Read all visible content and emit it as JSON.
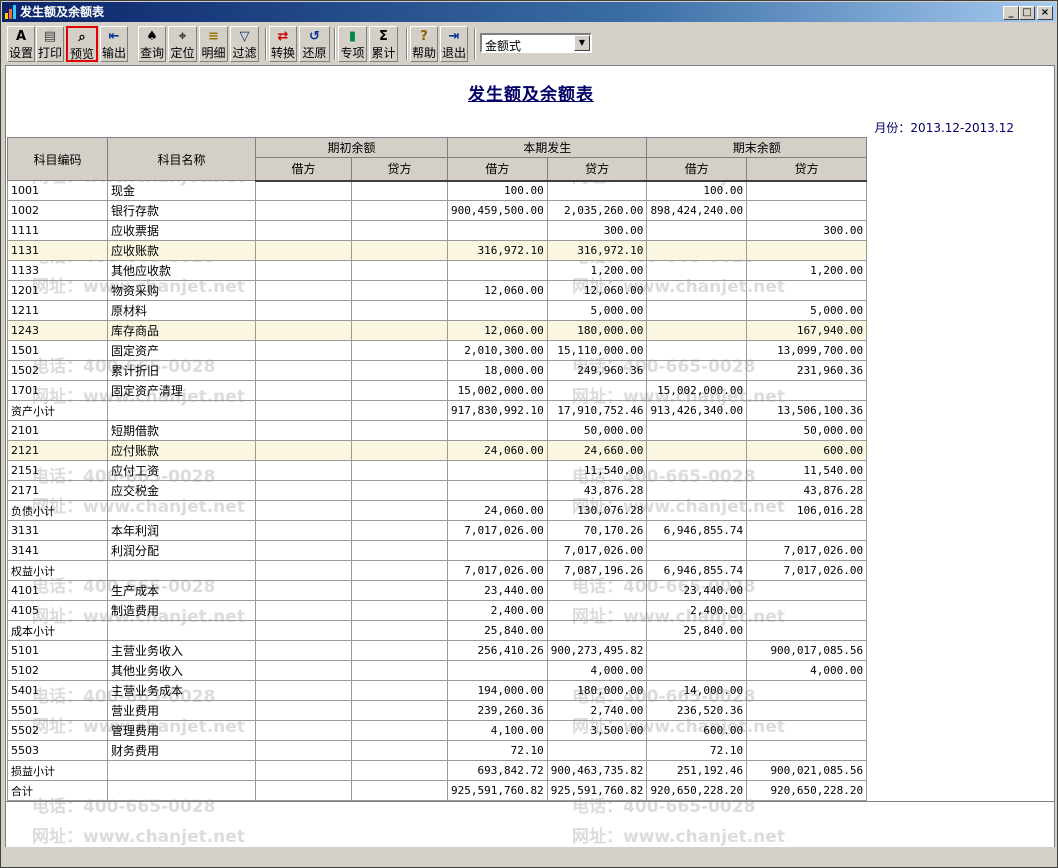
{
  "window": {
    "title": "发生额及余额表",
    "min": "_",
    "max": "□",
    "close": "×"
  },
  "toolbar": [
    {
      "id": "settings",
      "label": "设置"
    },
    {
      "id": "print",
      "label": "打印"
    },
    {
      "id": "preview",
      "label": "预览"
    },
    {
      "id": "export",
      "label": "输出"
    },
    {
      "id": "query",
      "label": "查询"
    },
    {
      "id": "locate",
      "label": "定位"
    },
    {
      "id": "detail",
      "label": "明细"
    },
    {
      "id": "filter",
      "label": "过滤"
    },
    {
      "id": "convert",
      "label": "转换"
    },
    {
      "id": "restore",
      "label": "还原"
    },
    {
      "id": "special",
      "label": "专项"
    },
    {
      "id": "cumulative",
      "label": "累计"
    },
    {
      "id": "help",
      "label": "帮助"
    },
    {
      "id": "exit",
      "label": "退出"
    }
  ],
  "format_select": {
    "value": "金额式"
  },
  "report": {
    "title": "发生额及余额表",
    "period": "月份：2013.12-2013.12"
  },
  "watermark": {
    "phone": "电话：400-665-0028",
    "site": "网址：www.chanjet.net"
  },
  "columns": {
    "code": "科目编码",
    "name": "科目名称",
    "opening": "期初余额",
    "current": "本期发生",
    "closing": "期末余额",
    "debit": "借方",
    "credit": "贷方"
  },
  "rows": [
    [
      "1001",
      "现金",
      "",
      "",
      "100.00",
      "",
      "100.00",
      ""
    ],
    [
      "1002",
      "银行存款",
      "",
      "",
      "900,459,500.00",
      "2,035,260.00",
      "898,424,240.00",
      ""
    ],
    [
      "1111",
      "应收票据",
      "",
      "",
      "",
      "300.00",
      "",
      "300.00"
    ],
    [
      "1131",
      "应收账款",
      "",
      "",
      "316,972.10",
      "316,972.10",
      "",
      ""
    ],
    [
      "1133",
      "其他应收款",
      "",
      "",
      "",
      "1,200.00",
      "",
      "1,200.00"
    ],
    [
      "1201",
      "物资采购",
      "",
      "",
      "12,060.00",
      "12,060.00",
      "",
      ""
    ],
    [
      "1211",
      "原材料",
      "",
      "",
      "",
      "5,000.00",
      "",
      "5,000.00"
    ],
    [
      "1243",
      "库存商品",
      "",
      "",
      "12,060.00",
      "180,000.00",
      "",
      "167,940.00"
    ],
    [
      "1501",
      "固定资产",
      "",
      "",
      "2,010,300.00",
      "15,110,000.00",
      "",
      "13,099,700.00"
    ],
    [
      "1502",
      "累计折旧",
      "",
      "",
      "18,000.00",
      "249,960.36",
      "",
      "231,960.36"
    ],
    [
      "1701",
      "固定资产清理",
      "",
      "",
      "15,002,000.00",
      "",
      "15,002,000.00",
      ""
    ],
    [
      "资产小计",
      "",
      "",
      "",
      "917,830,992.10",
      "17,910,752.46",
      "913,426,340.00",
      "13,506,100.36"
    ],
    [
      "2101",
      "短期借款",
      "",
      "",
      "",
      "50,000.00",
      "",
      "50,000.00"
    ],
    [
      "2121",
      "应付账款",
      "",
      "",
      "24,060.00",
      "24,660.00",
      "",
      "600.00"
    ],
    [
      "2151",
      "应付工资",
      "",
      "",
      "",
      "11,540.00",
      "",
      "11,540.00"
    ],
    [
      "2171",
      "应交税金",
      "",
      "",
      "",
      "43,876.28",
      "",
      "43,876.28"
    ],
    [
      "负债小计",
      "",
      "",
      "",
      "24,060.00",
      "130,076.28",
      "",
      "106,016.28"
    ],
    [
      "3131",
      "本年利润",
      "",
      "",
      "7,017,026.00",
      "70,170.26",
      "6,946,855.74",
      ""
    ],
    [
      "3141",
      "利润分配",
      "",
      "",
      "",
      "7,017,026.00",
      "",
      "7,017,026.00"
    ],
    [
      "权益小计",
      "",
      "",
      "",
      "7,017,026.00",
      "7,087,196.26",
      "6,946,855.74",
      "7,017,026.00"
    ],
    [
      "4101",
      "生产成本",
      "",
      "",
      "23,440.00",
      "",
      "23,440.00",
      ""
    ],
    [
      "4105",
      "制造费用",
      "",
      "",
      "2,400.00",
      "",
      "2,400.00",
      ""
    ],
    [
      "成本小计",
      "",
      "",
      "",
      "25,840.00",
      "",
      "25,840.00",
      ""
    ],
    [
      "5101",
      "主营业务收入",
      "",
      "",
      "256,410.26",
      "900,273,495.82",
      "",
      "900,017,085.56"
    ],
    [
      "5102",
      "其他业务收入",
      "",
      "",
      "",
      "4,000.00",
      "",
      "4,000.00"
    ],
    [
      "5401",
      "主营业务成本",
      "",
      "",
      "194,000.00",
      "180,000.00",
      "14,000.00",
      ""
    ],
    [
      "5501",
      "营业费用",
      "",
      "",
      "239,260.36",
      "2,740.00",
      "236,520.36",
      ""
    ],
    [
      "5502",
      "管理费用",
      "",
      "",
      "4,100.00",
      "3,500.00",
      "600.00",
      ""
    ],
    [
      "5503",
      "财务费用",
      "",
      "",
      "72.10",
      "",
      "72.10",
      ""
    ],
    [
      "损益小计",
      "",
      "",
      "",
      "693,842.72",
      "900,463,735.82",
      "251,192.46",
      "900,021,085.56"
    ],
    [
      "合计",
      "",
      "",
      "",
      "925,591,760.82",
      "925,591,760.82",
      "920,650,228.20",
      "920,650,228.20"
    ]
  ],
  "highlight_rows": [
    3,
    7,
    13
  ],
  "colors": {
    "title_blue": "#000066",
    "highlight": "#fbf6e0",
    "preview_border": "#e00000"
  }
}
